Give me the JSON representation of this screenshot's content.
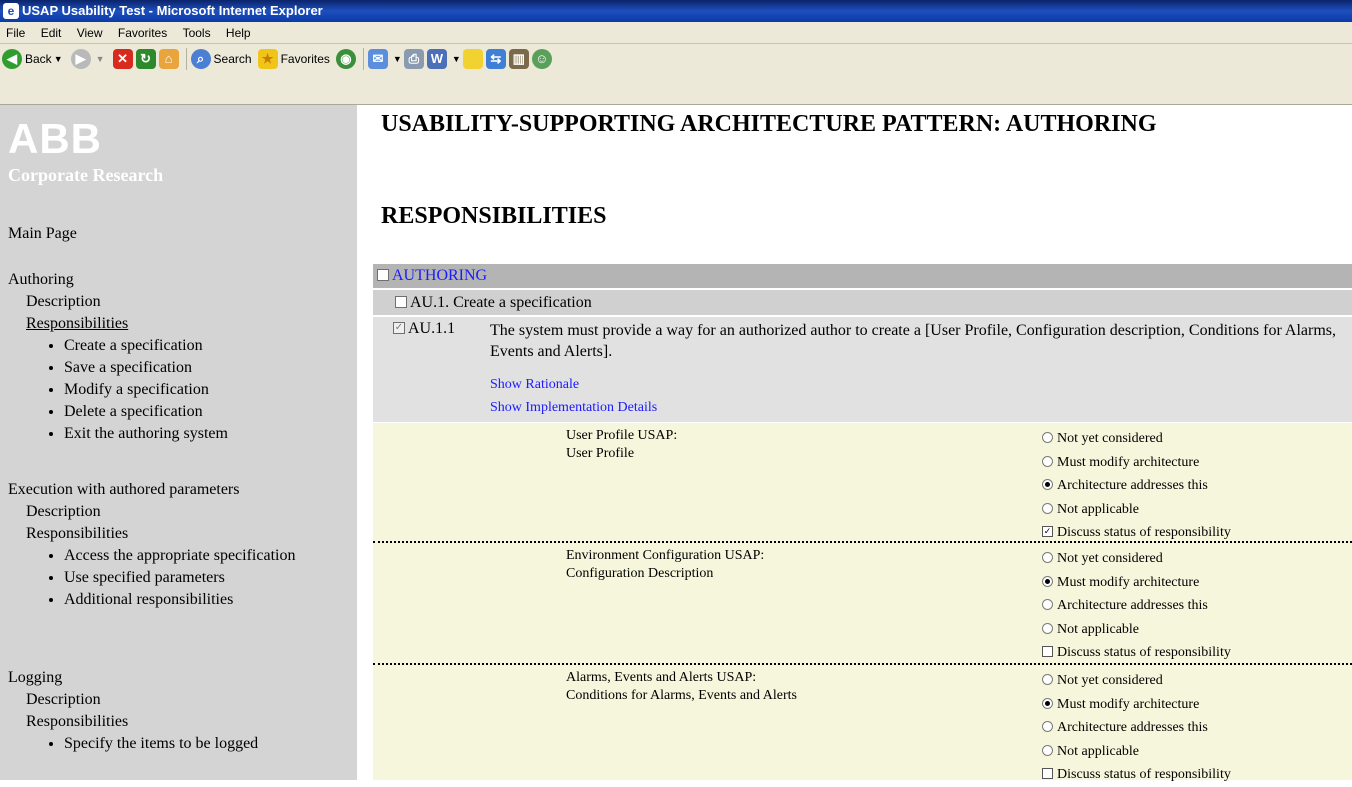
{
  "window": {
    "title": "USAP Usability Test - Microsoft Internet Explorer"
  },
  "menu": [
    "File",
    "Edit",
    "View",
    "Favorites",
    "Tools",
    "Help"
  ],
  "toolbar": {
    "back": "Back",
    "search": "Search",
    "favorites": "Favorites"
  },
  "sidebar": {
    "logo_main": "ABB",
    "logo_sub": "Corporate Research",
    "main_page": "Main Page",
    "sections": [
      {
        "title": "Authoring",
        "description": "Description",
        "responsibilities": "Responsibilities",
        "items": [
          "Create a specification",
          "Save a specification",
          "Modify a specification",
          "Delete a specification",
          "Exit the authoring system"
        ]
      },
      {
        "title": "Execution with authored parameters",
        "description": "Description",
        "responsibilities": "Responsibilities",
        "items": [
          "Access the appropriate specification",
          "Use specified parameters",
          "Additional responsibilities"
        ]
      },
      {
        "title": "Logging",
        "description": "Description",
        "responsibilities": "Responsibilities",
        "items": [
          "Specify the items to be logged"
        ]
      }
    ]
  },
  "main": {
    "page_title": "USABILITY-SUPPORTING ARCHITECTURE PATTERN: AUTHORING",
    "section_title": "RESPONSIBILITIES",
    "authoring_label": "AUTHORING",
    "au1_label": "AU.1. Create a specification",
    "au11_id": "AU.1.1",
    "au11_text": "The system must provide a way for an authorized author to create a [User Profile, Configuration description, Conditions for Alarms, Events and Alerts].",
    "show_rationale": "Show Rationale",
    "show_impl": "Show Implementation Details",
    "usaps": [
      {
        "name": "User Profile USAP:",
        "subname": "User Profile",
        "options": [
          "Not yet considered",
          "Must modify architecture",
          "Architecture addresses this",
          "Not applicable"
        ],
        "selected": 2,
        "discuss_label": "Discuss status of responsibility",
        "discuss_checked": true
      },
      {
        "name": "Environment Configuration USAP:",
        "subname": "Configuration Description",
        "options": [
          "Not yet considered",
          "Must modify architecture",
          "Architecture addresses this",
          "Not applicable"
        ],
        "selected": 1,
        "discuss_label": "Discuss status of responsibility",
        "discuss_checked": false
      },
      {
        "name": "Alarms, Events and Alerts USAP:",
        "subname": "Conditions for Alarms, Events and Alerts",
        "options": [
          "Not yet considered",
          "Must modify architecture",
          "Architecture addresses this",
          "Not applicable"
        ],
        "selected": 1,
        "discuss_label": "Discuss status of responsibility",
        "discuss_checked": false
      }
    ]
  }
}
